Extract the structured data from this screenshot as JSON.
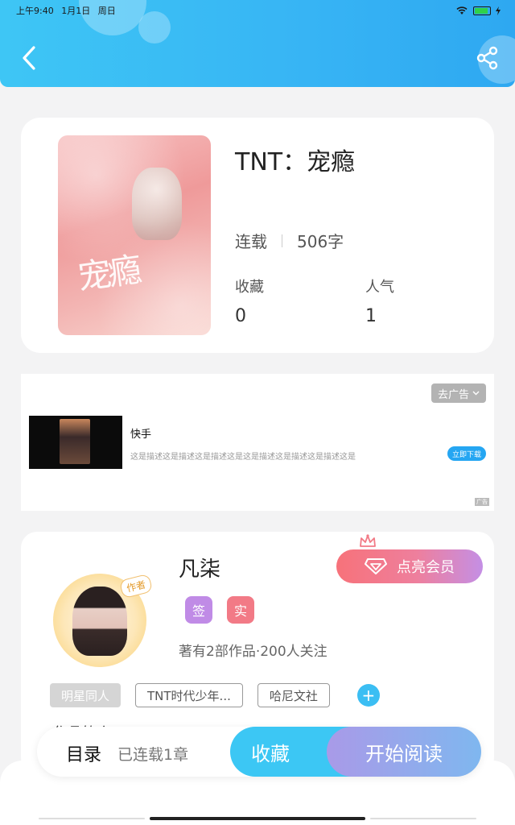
{
  "status_bar": {
    "time": "上午9:40",
    "date": "1月1日",
    "weekday": "周日",
    "battery": "100"
  },
  "book": {
    "title": "TNT：宠瘾",
    "cover_text": "宠瘾",
    "status": "连载",
    "word_count": "506字",
    "favorites_label": "收藏",
    "favorites_value": "0",
    "popularity_label": "人气",
    "popularity_value": "1"
  },
  "ad": {
    "remove_label": "去广告",
    "app_name": "快手",
    "description": "这是描述这是描述这是描述这是这是描述这是描述这是描述这是",
    "download_label": "立即下载",
    "ad_mark": "广告"
  },
  "author": {
    "name": "凡柒",
    "avatar_tag": "作者",
    "vip_label": "点亮会员",
    "badge_sign": "签",
    "badge_real": "实",
    "stats": "著有2部作品·200人关注",
    "tags": [
      "明星同人",
      "TNT时代少年...",
      "哈尼文社"
    ],
    "add_tag": "+",
    "partial_heading": "作品简介"
  },
  "action_bar": {
    "toc_label": "目录",
    "toc_sub": "已连载1章",
    "collect_label": "收藏",
    "read_label": "开始阅读"
  },
  "colors": {
    "header": "#37b4f4",
    "accent_blue": "#3cc7f4",
    "vip_gradient_start": "#f7727a",
    "vip_gradient_end": "#c48fe5",
    "badge_sign": "#c08be6",
    "badge_real": "#f27a86"
  },
  "icons": [
    "back-arrow-icon",
    "share-icon",
    "wifi-icon",
    "battery-icon",
    "chevron-down-icon",
    "crown-icon",
    "diamond-icon",
    "plus-icon"
  ]
}
